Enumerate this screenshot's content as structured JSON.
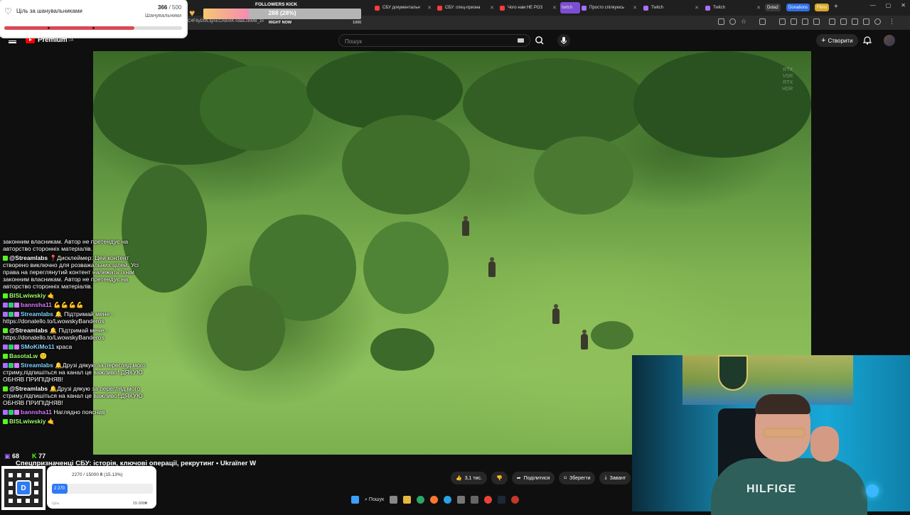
{
  "browser": {
    "tabs": [
      {
        "label": "СБУ документальн",
        "color": "#ff4444"
      },
      {
        "label": "СБУ: спец-призна",
        "color": "#ff4444"
      },
      {
        "label": "Чого нам НЕ РОЗ",
        "color": "#ff4444"
      },
      {
        "label": "twitch",
        "color": "#a970ff"
      },
      {
        "label": "Просто спілкуюсь",
        "color": "#a970ff"
      },
      {
        "label": "Twitch",
        "color": "#a970ff"
      },
      {
        "label": "Twitch",
        "color": "#a970ff"
      }
    ],
    "pills": [
      {
        "label": "Dota2",
        "color": "#3a3a3a"
      },
      {
        "label": "Donations",
        "color": "#2f6fe4"
      },
      {
        "label": "Films",
        "color": "#d8a82a"
      }
    ],
    "url": "C4F8yDt9LtgAECABAIK-ndaE2BMB_zx"
  },
  "youtube": {
    "logo_text": "Premium",
    "logo_superscript": "UA",
    "search_placeholder": "Пошук",
    "create_label": "Створити",
    "video_title": "Спецпризначенці СБУ: історія, ключові операції, рекрутинг • Ukraїner W",
    "like_count": "3,1 тис.",
    "share_label": "Поділитися",
    "save_label": "Зберегти",
    "download_label": "Завант",
    "overlay_text": [
      "RTX",
      "VSR",
      "RTX",
      "HDR"
    ]
  },
  "follower_goal": {
    "title": "Ціль за шанувальниками",
    "current": "366",
    "target": "/ 500",
    "subtitle": "Шанувальники",
    "progress": 0.732
  },
  "kick_goal": {
    "label": "FOLLOWERS KICK",
    "value_text": "288 (28%)",
    "progress": 0.288,
    "now_label": "RIGHT NOW",
    "max_label": "1000"
  },
  "chat": [
    {
      "user": "",
      "color": "#fff",
      "text": "законним власникам. Автор не претендує на авторство сторонніх матеріалів."
    },
    {
      "user": "@Streamlabs",
      "color": "#fff",
      "badge": "kick",
      "text": "📍Дисклеймер: Цей контент створено виключно для розважальних цілей. Усі права на переглянутий контент належать їхнім законним власникам. Автор не претендує на авторство сторонніх матеріалів."
    },
    {
      "user": "BISLwiwskiy",
      "color": "#9cff6b",
      "badge": "kick",
      "text": "🤙"
    },
    {
      "user": "bannsha11",
      "color": "#d77bff",
      "badge": "twitch3",
      "text": "💪💪💪💪"
    },
    {
      "user": "Streamlabs",
      "color": "#7fd4ff",
      "badge": "twitch3",
      "text": "🔔 Підтримай мене - https://donatello.to/LwowskyBanderos"
    },
    {
      "user": "@Streamlabs",
      "color": "#fff",
      "badge": "kick",
      "text": "🔔 Підтримай мене - https://donatello.to/LwowskyBanderos"
    },
    {
      "user": "SMoKiMo11",
      "color": "#7fd4ff",
      "badge": "twitch3",
      "text": "краса"
    },
    {
      "user": "BasotaLw",
      "color": "#9cff6b",
      "badge": "kick",
      "text": "🙂"
    },
    {
      "user": "Streamlabs",
      "color": "#7fd4ff",
      "badge": "twitch3",
      "text": "🔔Друзі дякую за перегляд мого стриму,підпишіться на канал це важливо! ДЯКУЮ ОБНЯВ ПРИПІДНЯВ!"
    },
    {
      "user": "@Streamlabs",
      "color": "#fff",
      "badge": "kick",
      "text": "🔔Друзі дякую за перегляд мого стриму,підпишіться на канал це важливо! ДЯКУЮ ОБНЯВ ПРИПІДНЯВ!"
    },
    {
      "user": "bannsha11",
      "color": "#d77bff",
      "badge": "twitch3",
      "text": "Наглядно пояснив"
    },
    {
      "user": "BISLwiwskiy",
      "color": "#9cff6b",
      "badge": "kick",
      "text": "🤙"
    }
  ],
  "chat_stats": {
    "twitch_viewers": "68",
    "kick_viewers": "77"
  },
  "donation": {
    "text": "2270 / 15000 ₴ (15.13%)",
    "fill_label": "2 270",
    "progress": 0.1513,
    "min_label": "Ціль",
    "max_label": "15 000₴",
    "qr_letter": "D"
  },
  "taskbar": {
    "search_label": "Пошук"
  },
  "webcam": {
    "shirt_text": "HILFIGE"
  }
}
